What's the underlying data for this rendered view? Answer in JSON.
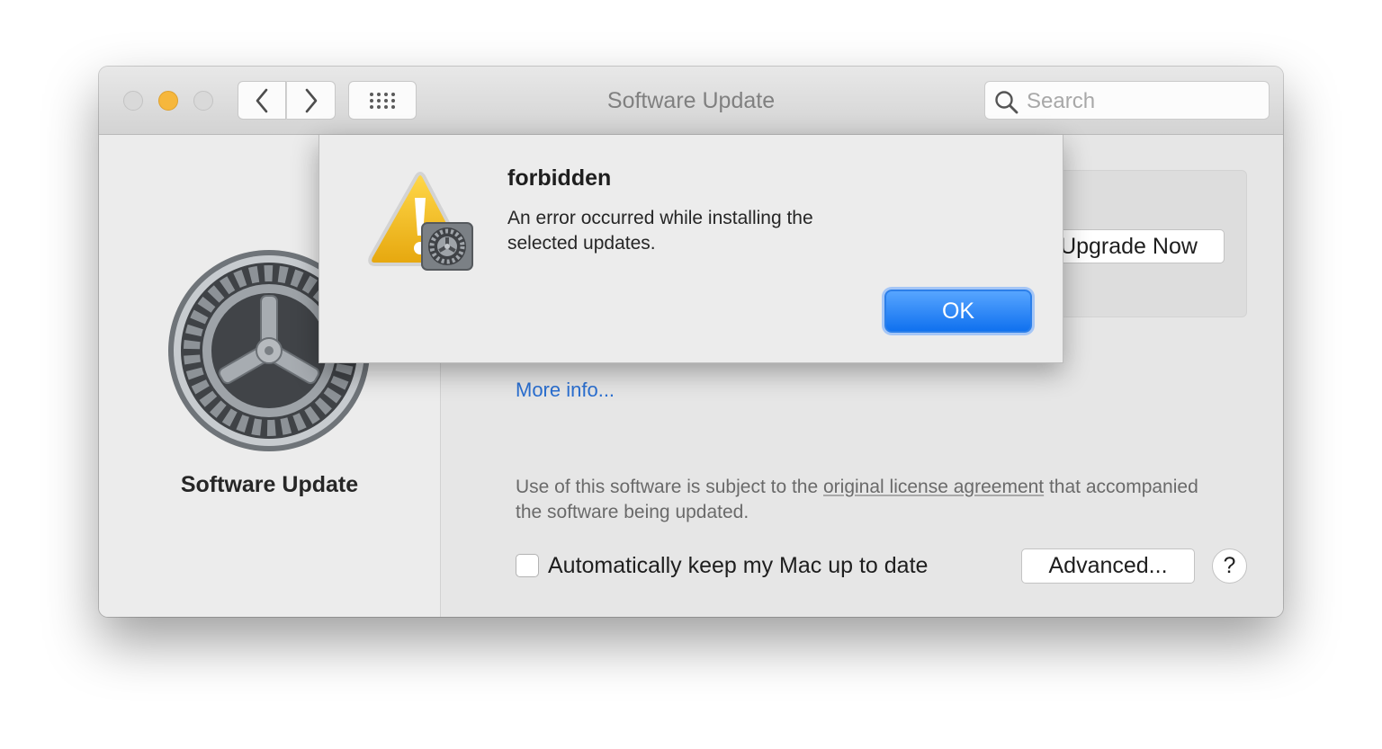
{
  "window": {
    "title": "Software Update",
    "search_placeholder": "Search",
    "traffic_lights": [
      "close-button",
      "minimize-button",
      "zoom-button"
    ],
    "toolbar_icons": [
      "chevron-left-icon",
      "chevron-right-icon",
      "grid-icon"
    ]
  },
  "sidebar": {
    "pane_title": "Software Update",
    "icon": "gear-icon"
  },
  "content": {
    "upgrade_button": "Upgrade Now",
    "more_info": "More info...",
    "license_prefix": "Use of this software is subject to the ",
    "license_link": "original license agreement",
    "license_suffix": " that accompanied the software being updated.",
    "auto_update_label": "Automatically keep my Mac up to date",
    "auto_update_checked": false,
    "advanced_button": "Advanced...",
    "help_button": "?"
  },
  "alert": {
    "title": "forbidden",
    "message": "An error occurred while installing the selected updates.",
    "ok_button": "OK",
    "icon": "warning-icon"
  },
  "colors": {
    "accent": "#1a7cf2",
    "link": "#2a6fd1",
    "minimize": "#f6b73c"
  }
}
